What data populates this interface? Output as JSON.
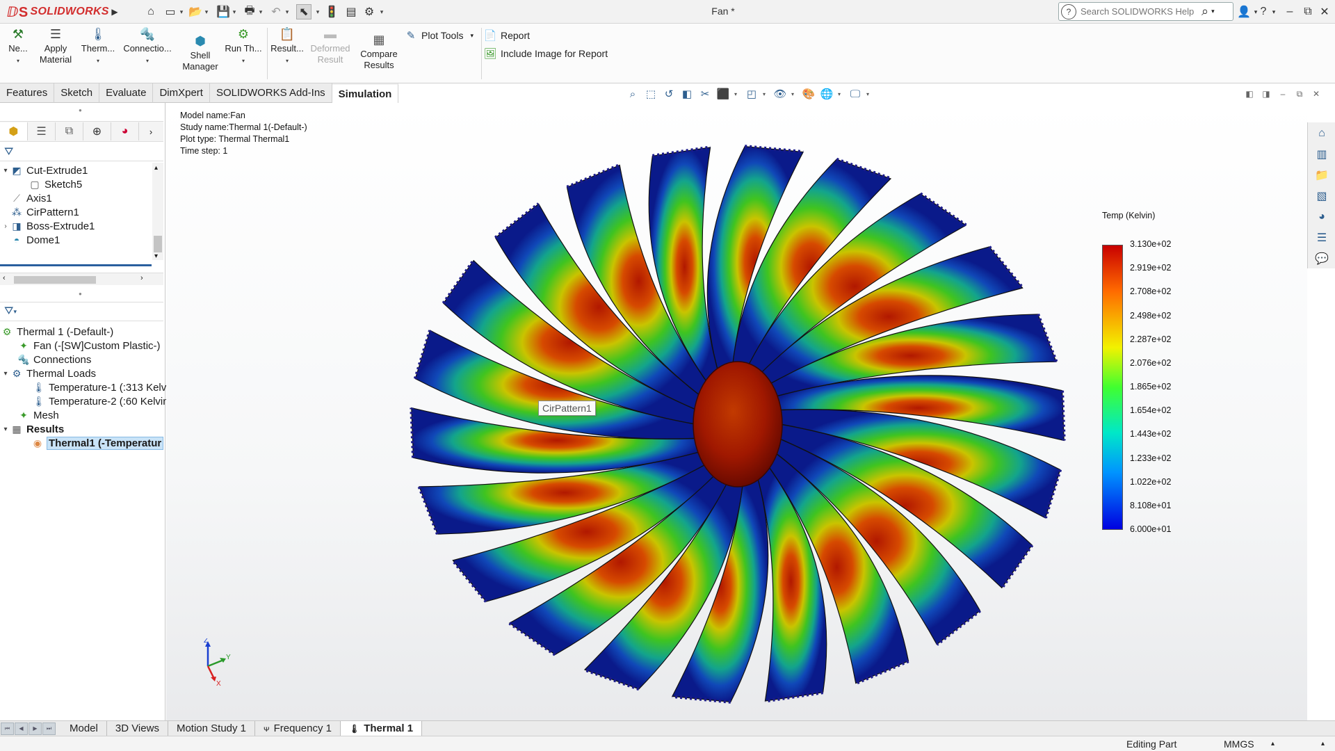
{
  "app": {
    "logo_text": "SOLIDWORKS",
    "doc_title": "Fan *"
  },
  "search": {
    "placeholder": "Search SOLIDWORKS Help"
  },
  "ribbon": {
    "new_label": "Ne...",
    "apply_material_line1": "Apply",
    "apply_material_line2": "Material",
    "thermal_label": "Therm...",
    "connections_label": "Connectio...",
    "shell_line1": "Shell",
    "shell_line2": "Manager",
    "run_label": "Run Th...",
    "results_label": "Result...",
    "deformed_line1": "Deformed",
    "deformed_line2": "Result",
    "compare_line1": "Compare",
    "compare_line2": "Results",
    "plot_tools_label": "Plot Tools",
    "report_label": "Report",
    "include_image_label": "Include Image for Report"
  },
  "cm_tabs": [
    "Features",
    "Sketch",
    "Evaluate",
    "DimXpert",
    "SOLIDWORKS Add-Ins",
    "Simulation"
  ],
  "feature_tree": [
    {
      "label": "Cut-Extrude1",
      "icon": "cut-extrude-icon",
      "expand": "▾"
    },
    {
      "label": "Sketch5",
      "icon": "sketch-icon",
      "expand": ""
    },
    {
      "label": "Axis1",
      "icon": "axis-icon",
      "expand": ""
    },
    {
      "label": "CirPattern1",
      "icon": "circular-pattern-icon",
      "expand": ""
    },
    {
      "label": "Boss-Extrude1",
      "icon": "boss-extrude-icon",
      "expand": "›"
    },
    {
      "label": "Dome1",
      "icon": "dome-icon",
      "expand": ""
    }
  ],
  "sim_tree": [
    {
      "label": "Thermal 1 (-Default-)",
      "icon": "thermal-study-icon",
      "expand": ""
    },
    {
      "label": "Fan (-[SW]Custom Plastic-)",
      "icon": "part-material-icon",
      "expand": ""
    },
    {
      "label": "Connections",
      "icon": "connections-icon",
      "expand": ""
    },
    {
      "label": "Thermal Loads",
      "icon": "thermal-loads-icon",
      "expand": "▾"
    },
    {
      "label": "Temperature-1 (:313 Kelv",
      "icon": "thermometer-icon",
      "expand": ""
    },
    {
      "label": "Temperature-2 (:60 Kelvin",
      "icon": "thermometer-icon",
      "expand": ""
    },
    {
      "label": "Mesh",
      "icon": "mesh-icon",
      "expand": ""
    },
    {
      "label": "Results",
      "icon": "results-folder-icon",
      "expand": "▾"
    },
    {
      "label": "Thermal1 (-Temperatur",
      "icon": "thermal-plot-icon",
      "expand": ""
    }
  ],
  "study_info": {
    "model": "Model name:Fan",
    "study": "Study name:Thermal 1(-Default-)",
    "plot_type": "Plot type: Thermal Thermal1",
    "time_step": "Time step: 1"
  },
  "legend": {
    "title": "Temp (Kelvin)",
    "ticks": [
      "3.130e+02",
      "2.919e+02",
      "2.708e+02",
      "2.498e+02",
      "2.287e+02",
      "2.076e+02",
      "1.865e+02",
      "1.654e+02",
      "1.443e+02",
      "1.233e+02",
      "1.022e+02",
      "8.108e+01",
      "6.000e+01"
    ],
    "max_color": "#c80000",
    "min_color": "#0000e0"
  },
  "tooltip": "CirPattern1",
  "triad": {
    "z": "Z",
    "y": "Y",
    "x": "X"
  },
  "bottom_tabs": [
    "Model",
    "3D Views",
    "Motion Study 1",
    "Frequency 1",
    "Thermal 1"
  ],
  "status": {
    "mode": "Editing Part",
    "units": "MMGS"
  }
}
